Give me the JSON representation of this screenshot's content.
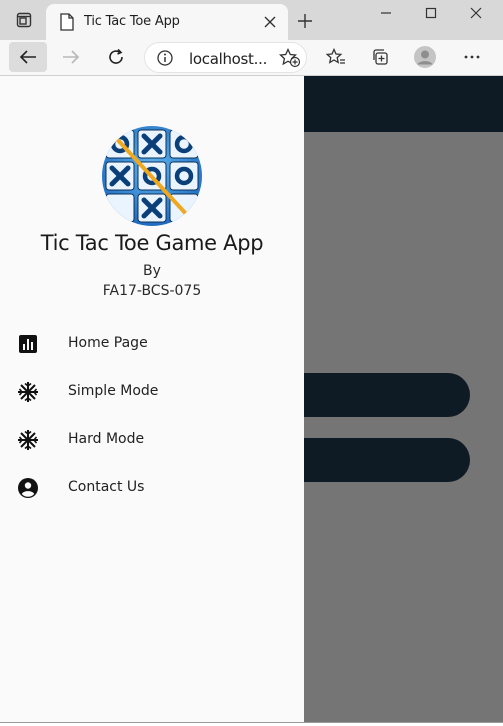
{
  "browser": {
    "tab_title": "Tic Tac Toe App",
    "address_url": "localhost..."
  },
  "drawer": {
    "app_title": "Tic Tac Toe Game App",
    "by_label": "By",
    "roll_number": "FA17-BCS-075",
    "items": [
      {
        "label": "Home Page",
        "icon": "bar-chart-icon"
      },
      {
        "label": "Simple Mode",
        "icon": "snowflake-icon"
      },
      {
        "label": "Hard Mode",
        "icon": "snowflake-icon"
      },
      {
        "label": "Contact Us",
        "icon": "account-circle-icon"
      }
    ]
  },
  "colors": {
    "app_bar": "#1f3b52",
    "drawer_bg": "#fafafa",
    "scrim": "rgba(0,0,0,0.54)",
    "logo_bg": "#1f7fd0",
    "logo_line": "#f0a81e"
  }
}
